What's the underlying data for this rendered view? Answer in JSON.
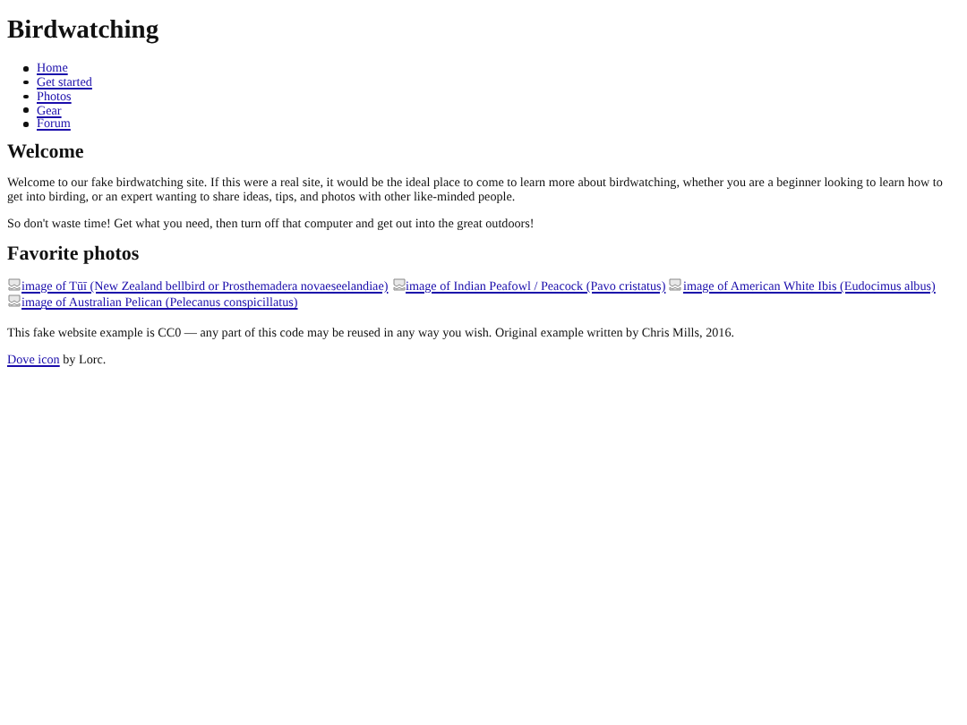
{
  "title": "Birdwatching",
  "nav": [
    "Home",
    "Get started",
    "Photos",
    "Gear",
    "Forum"
  ],
  "welcome": {
    "heading": "Welcome",
    "paragraphs": [
      "Welcome to our fake birdwatching site. If this were a real site, it would be the ideal place to come to learn more about birdwatching, whether you are a beginner looking to learn how to get into birding, or an expert wanting to share ideas, tips, and photos with other like-minded people.",
      "So don't waste time! Get what you need, then turn off that computer and get out into the great outdoors!"
    ]
  },
  "photos": {
    "heading": "Favorite photos",
    "items": [
      "image of Tūī (New Zealand bellbird or Prosthemadera novaeseelandiae)",
      "image of Indian Peafowl / Peacock (Pavo cristatus)",
      "image of American White Ibis (Eudocimus albus)",
      "image of Australian Pelican (Pelecanus conspicillatus)"
    ]
  },
  "footer": {
    "license": "This fake website example is CC0 — any part of this code may be reused in any way you wish. Original example written by Chris Mills, 2016.",
    "credit_link": "Dove icon",
    "credit_text": " by Lorc."
  }
}
